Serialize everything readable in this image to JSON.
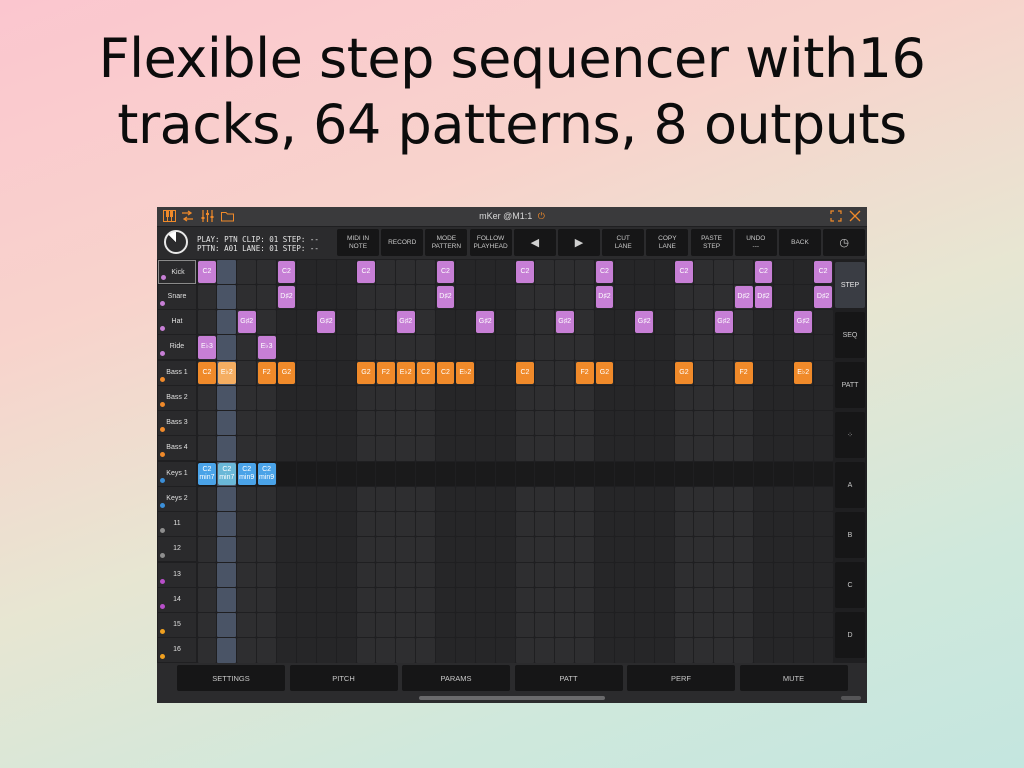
{
  "headline": {
    "line1": "Flexible step sequencer with16",
    "line2": "tracks, 64 patterns, 8 outputs"
  },
  "window": {
    "title": "mKer @M1:1",
    "power_icon": "power-icon"
  },
  "titlebar_icons_left": [
    "piano-keys-icon",
    "routing-icon",
    "mixer-faders-icon",
    "folder-icon"
  ],
  "titlebar_icons_right": [
    "fullscreen-icon",
    "close-icon"
  ],
  "status": {
    "line1": "PLAY: PTN CLIP: 01 STEP: --",
    "line2": "PTTN: A01 LANE: 01 STEP: --"
  },
  "toolbar": [
    {
      "name": "midi-in-note-button",
      "label": "MIDI IN\nNOTE"
    },
    {
      "name": "record-button",
      "label": "RECORD"
    },
    {
      "name": "mode-pattern-button",
      "label": "MODE\nPATTERN"
    },
    {
      "name": "follow-playhead-button",
      "label": "FOLLOW\nPLAYHEAD"
    },
    {
      "name": "prev-button",
      "label": "◀"
    },
    {
      "name": "next-button",
      "label": "▶"
    },
    {
      "name": "cut-lane-button",
      "label": "CUT\nLANE"
    },
    {
      "name": "copy-lane-button",
      "label": "COPY\nLANE"
    },
    {
      "name": "paste-step-button",
      "label": "PASTE\nSTEP"
    },
    {
      "name": "undo-button",
      "label": "UNDO\n---"
    },
    {
      "name": "back-button",
      "label": "BACK"
    },
    {
      "name": "clock-button",
      "label": "◷"
    }
  ],
  "tracks": [
    {
      "label": "Kick",
      "color": "#c77fd6",
      "selected": true
    },
    {
      "label": "Snare",
      "color": "#c77fd6"
    },
    {
      "label": "Hat",
      "color": "#c77fd6"
    },
    {
      "label": "Ride",
      "color": "#c77fd6"
    },
    {
      "label": "Bass 1",
      "color": "#f08a2a"
    },
    {
      "label": "Bass 2",
      "color": "#f08a2a"
    },
    {
      "label": "Bass 3",
      "color": "#f08a2a"
    },
    {
      "label": "Bass 4",
      "color": "#f08a2a"
    },
    {
      "label": "Keys 1",
      "color": "#3b8fd9"
    },
    {
      "label": "Keys 2",
      "color": "#3b8fd9"
    },
    {
      "label": "11",
      "color": "#8e8e8e"
    },
    {
      "label": "12",
      "color": "#8e8e8e"
    },
    {
      "label": "13",
      "color": "#b84fc9"
    },
    {
      "label": "14",
      "color": "#b84fc9"
    },
    {
      "label": "15",
      "color": "#f0a020"
    },
    {
      "label": "16",
      "color": "#f0a020"
    }
  ],
  "steps": 32,
  "playhead_step": 1,
  "colors": {
    "kit": "#c77fd6",
    "bass": "#f08a2a",
    "bass_playing": "#f5ae62",
    "keys": "#4aa3e8",
    "keys_playing": "#6ab8d8"
  },
  "notes": [
    {
      "row": 0,
      "step": 0,
      "label": "C2",
      "kind": "kit"
    },
    {
      "row": 0,
      "step": 4,
      "label": "C2",
      "kind": "kit"
    },
    {
      "row": 0,
      "step": 8,
      "label": "C2",
      "kind": "kit"
    },
    {
      "row": 0,
      "step": 12,
      "label": "C2",
      "kind": "kit"
    },
    {
      "row": 0,
      "step": 16,
      "label": "C2",
      "kind": "kit"
    },
    {
      "row": 0,
      "step": 20,
      "label": "C2",
      "kind": "kit"
    },
    {
      "row": 0,
      "step": 24,
      "label": "C2",
      "kind": "kit"
    },
    {
      "row": 0,
      "step": 28,
      "label": "C2",
      "kind": "kit"
    },
    {
      "row": 0,
      "step": 31,
      "label": "C2",
      "kind": "kit"
    },
    {
      "row": 1,
      "step": 4,
      "label": "D♯2",
      "kind": "kit"
    },
    {
      "row": 1,
      "step": 12,
      "label": "D♯2",
      "kind": "kit"
    },
    {
      "row": 1,
      "step": 20,
      "label": "D♯2",
      "kind": "kit"
    },
    {
      "row": 1,
      "step": 27,
      "label": "D♯2",
      "kind": "kit"
    },
    {
      "row": 1,
      "step": 28,
      "label": "D♯2",
      "kind": "kit"
    },
    {
      "row": 1,
      "step": 31,
      "label": "D♯2",
      "kind": "kit"
    },
    {
      "row": 2,
      "step": 2,
      "label": "G♯2",
      "kind": "kit"
    },
    {
      "row": 2,
      "step": 6,
      "label": "G♯2",
      "kind": "kit"
    },
    {
      "row": 2,
      "step": 10,
      "label": "G♯2",
      "kind": "kit"
    },
    {
      "row": 2,
      "step": 14,
      "label": "G♯2",
      "kind": "kit"
    },
    {
      "row": 2,
      "step": 18,
      "label": "G♯2",
      "kind": "kit"
    },
    {
      "row": 2,
      "step": 22,
      "label": "G♯2",
      "kind": "kit"
    },
    {
      "row": 2,
      "step": 26,
      "label": "G♯2",
      "kind": "kit"
    },
    {
      "row": 2,
      "step": 30,
      "label": "G♯2",
      "kind": "kit"
    },
    {
      "row": 3,
      "step": 0,
      "label": "E♭3",
      "kind": "kit"
    },
    {
      "row": 3,
      "step": 3,
      "label": "E♭3",
      "kind": "kit"
    },
    {
      "row": 4,
      "step": 0,
      "label": "C2",
      "kind": "bass"
    },
    {
      "row": 4,
      "step": 1,
      "label": "E♭2",
      "kind": "bass_playing"
    },
    {
      "row": 4,
      "step": 3,
      "label": "F2",
      "kind": "bass"
    },
    {
      "row": 4,
      "step": 4,
      "label": "G2",
      "kind": "bass"
    },
    {
      "row": 4,
      "step": 8,
      "label": "G2",
      "kind": "bass"
    },
    {
      "row": 4,
      "step": 9,
      "label": "F2",
      "kind": "bass"
    },
    {
      "row": 4,
      "step": 10,
      "label": "E♭2",
      "kind": "bass"
    },
    {
      "row": 4,
      "step": 11,
      "label": "C2",
      "kind": "bass"
    },
    {
      "row": 4,
      "step": 12,
      "label": "C2",
      "kind": "bass"
    },
    {
      "row": 4,
      "step": 13,
      "label": "E♭2",
      "kind": "bass"
    },
    {
      "row": 4,
      "step": 16,
      "label": "C2",
      "kind": "bass"
    },
    {
      "row": 4,
      "step": 19,
      "label": "F2",
      "kind": "bass"
    },
    {
      "row": 4,
      "step": 20,
      "label": "G2",
      "kind": "bass"
    },
    {
      "row": 4,
      "step": 24,
      "label": "G2",
      "kind": "bass"
    },
    {
      "row": 4,
      "step": 27,
      "label": "F2",
      "kind": "bass"
    },
    {
      "row": 4,
      "step": 30,
      "label": "E♭2",
      "kind": "bass"
    },
    {
      "row": 8,
      "step": 0,
      "label": "C2 min7",
      "kind": "keys"
    },
    {
      "row": 8,
      "step": 1,
      "label": "C2 min7",
      "kind": "keys_playing"
    },
    {
      "row": 8,
      "step": 2,
      "label": "C2 min9",
      "kind": "keys"
    },
    {
      "row": 8,
      "step": 3,
      "label": "C2 min9",
      "kind": "keys"
    }
  ],
  "side_buttons": [
    {
      "name": "step-mode-button",
      "label": "STEP",
      "active": true
    },
    {
      "name": "seq-mode-button",
      "label": "SEQ"
    },
    {
      "name": "patt-mode-button",
      "label": "PATT"
    },
    {
      "name": "random-button",
      "label": "⁘",
      "icon": "sparkle-icon"
    },
    {
      "name": "bank-a-button",
      "label": "A"
    },
    {
      "name": "bank-b-button",
      "label": "B"
    },
    {
      "name": "bank-c-button",
      "label": "C"
    },
    {
      "name": "bank-d-button",
      "label": "D"
    }
  ],
  "bottom_tabs": [
    {
      "name": "settings-tab",
      "label": "SETTINGS"
    },
    {
      "name": "pitch-tab",
      "label": "PITCH"
    },
    {
      "name": "params-tab",
      "label": "PARAMS"
    },
    {
      "name": "patt-tab",
      "label": "PATT"
    },
    {
      "name": "perf-tab",
      "label": "PERF"
    },
    {
      "name": "mute-tab",
      "label": "MUTE"
    }
  ]
}
